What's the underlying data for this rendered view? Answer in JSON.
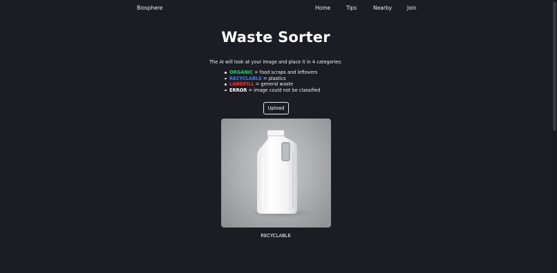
{
  "nav": {
    "brand": "Biosphere",
    "links": [
      "Home",
      "Tips",
      "Nearby",
      "Join"
    ]
  },
  "main": {
    "title": "Waste Sorter",
    "intro": "The AI will look at your image and place it in 4 categories:",
    "categories": [
      {
        "name": "ORGANIC",
        "desc": "= food scraps and leftovers",
        "color": "#2ecc71"
      },
      {
        "name": "RECYCLABLE",
        "desc": "= plastics",
        "color": "#3a7bff"
      },
      {
        "name": "LANDFILL",
        "desc": "= general waste",
        "color": "#e53935"
      },
      {
        "name": "ERROR",
        "desc": "= image could not be classified",
        "color": "#ffffff"
      }
    ],
    "upload_label": "Upload",
    "image_icon": "plastic-jug-photo",
    "result": "RECYCLABLE"
  },
  "colors": {
    "background": "#1c1d24",
    "text": "#ffffff"
  }
}
